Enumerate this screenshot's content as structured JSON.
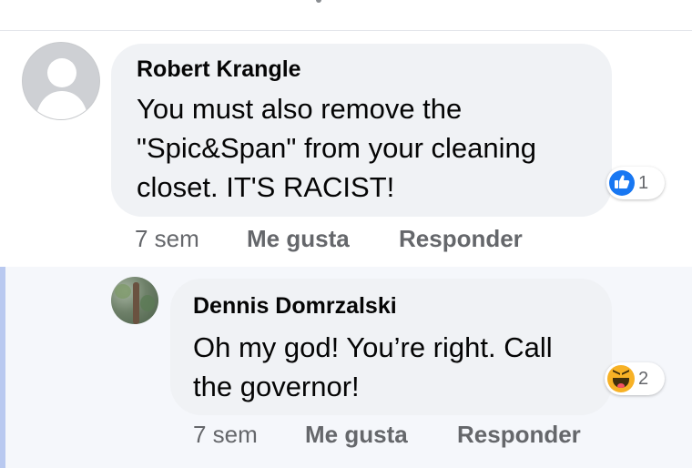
{
  "comments": [
    {
      "author": "Robert Krangle",
      "text": "You must also remove the\n\"Spic&Span\" from your cleaning\ncloset. IT'S RACIST!",
      "reaction_count": "1",
      "reaction_icon": "like-icon",
      "time": "7 sem",
      "like_label": "Me gusta",
      "reply_label": "Responder"
    },
    {
      "author": "Dennis Domrzalski",
      "text": "Oh my god! You’re right. Call\nthe governor!",
      "reaction_count": "2",
      "reaction_icon": "haha-icon",
      "time": "7 sem",
      "like_label": "Me gusta",
      "reply_label": "Responder"
    }
  ],
  "colors": {
    "bubble": "#f0f2f5",
    "meta_text": "#65676b",
    "like_blue": "#1877f2",
    "haha_yellow": "#f7b125",
    "reply_highlight": "#f5f7fb"
  }
}
